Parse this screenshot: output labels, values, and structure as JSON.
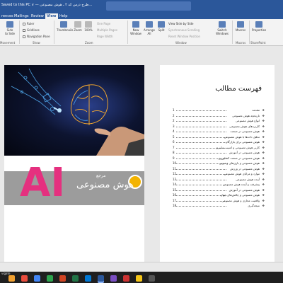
{
  "window": {
    "title": "Saved to this PC ∨ — طرح درس کد ۲ ـ هوش مصنوعی..."
  },
  "tabs": [
    {
      "label": "rences",
      "active": false
    },
    {
      "label": "Mailings",
      "active": false
    },
    {
      "label": "Review",
      "active": false
    },
    {
      "label": "View",
      "active": true
    },
    {
      "label": "Help",
      "active": false
    }
  ],
  "ribbon": {
    "side_to_side": "Side\nto Side",
    "ruler": "Ruler",
    "gridlines": "Gridlines",
    "navigation_pane": "Navigation Pane",
    "show_group": "Show",
    "thumbnails": "Thumbnails",
    "zoom": "Zoom",
    "zoom_100": "100%",
    "one_page": "One Page",
    "multiple_pages": "Multiple Pages",
    "page_width": "Page Width",
    "zoom_group": "Zoom",
    "new_window": "New\nWindow",
    "arrange_all": "Arrange\nAll",
    "split": "Split",
    "view_side_by_side": "View Side by Side",
    "synchronous_scrolling": "Synchronous Scrolling",
    "reset_window_position": "Reset Window Position",
    "switch_windows": "Switch\nWindows",
    "window_group": "Window",
    "macros": "Macros",
    "macros_group": "Macros",
    "properties": "Properties",
    "sharepoint_group": "SharePoint",
    "movement_group": "Movement"
  },
  "cover": {
    "ai_text": "AI",
    "subtitle_pre": "مرجع",
    "title": "هوش مصنوعی"
  },
  "toc": {
    "heading": "فهرست مطالب",
    "items": [
      {
        "title": "مقدمه",
        "page": "1"
      },
      {
        "title": "تاریخچه هوش مصنوعی",
        "page": "2"
      },
      {
        "title": "انواع هوش مصنوعی",
        "page": "2"
      },
      {
        "title": "کاربردهای هوش مصنوعی",
        "page": "3"
      },
      {
        "title": "هوش مصنوعی در صنعت",
        "page": "4"
      },
      {
        "title": "تحلیل داده‌ها با هوش مصنوعی",
        "page": "5"
      },
      {
        "title": "هوش مصنوعی برای بازارگان",
        "page": "6"
      },
      {
        "title": "کاربر هوش مصنوعی و امنیت سایبری",
        "page": "7"
      },
      {
        "title": "هوش مصنوعی در آموزش",
        "page": "8"
      },
      {
        "title": "هوش مصنوعی در صنعت کشاورزی",
        "page": "9"
      },
      {
        "title": "هوش مصنوعی و بازی‌های ویدیویی",
        "page": "10"
      },
      {
        "title": "هوش مصنوعی در ورزش",
        "page": "11"
      },
      {
        "title": "موارد و مزایای هوش مصنوعی",
        "page": "12"
      },
      {
        "title": "آینده هوش مصنوعی",
        "page": "13"
      },
      {
        "title": "پیشرفت و آینده هوش مصنوعی",
        "page": "14"
      },
      {
        "title": "هوش مصنوعی در آموزش",
        "page": "15"
      },
      {
        "title": "هوش مصنوعی و چالش‌های جهان",
        "page": "16"
      },
      {
        "title": "واقعیت مجازی و هوش مصنوعی",
        "page": "17"
      },
      {
        "title": "نتیجه‌گیری",
        "page": "18"
      }
    ]
  },
  "taskbar": {
    "label": "vigate"
  },
  "colors": {
    "accent": "#2b579a",
    "ai_pink": "#e5307f",
    "banner_grey": "#9c9c9c"
  }
}
